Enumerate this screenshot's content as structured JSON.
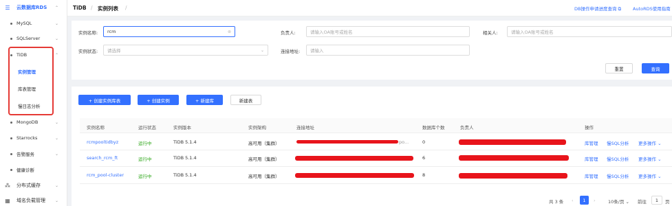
{
  "sidebar": {
    "top": {
      "label": "云数据库RDS",
      "icon": "grid-menu-icon"
    },
    "items": [
      {
        "label": "MySQL"
      },
      {
        "label": "SQLServer"
      },
      {
        "label": "TiDB"
      },
      {
        "label": "实例管理"
      },
      {
        "label": "库表管理"
      },
      {
        "label": "慢日志分析"
      },
      {
        "label": "MongoDB"
      },
      {
        "label": "Starrocks"
      },
      {
        "label": "告警服务"
      },
      {
        "label": "健康诊断"
      },
      {
        "label": "分布式缓存"
      },
      {
        "label": "域名负载管理"
      }
    ]
  },
  "header": {
    "crumb1": "TiDB",
    "sep1": "/",
    "crumb2": "实例列表",
    "sep2": "/",
    "link1": "DB操作申请进度查询",
    "link2": "AutoRDS使用指南"
  },
  "search": {
    "name_label": "实例名称:",
    "name_value": "rcm",
    "owner_label": "负责人:",
    "owner_placeholder": "请输入OA账号或姓名",
    "related_label": "相关人:",
    "related_placeholder": "请输入OA账号或姓名",
    "status_label": "实例状态:",
    "status_placeholder": "请选择",
    "addr_label": "连接地址:",
    "addr_placeholder": "请输入",
    "reset": "重置",
    "query": "查询"
  },
  "toolbar": {
    "create_db_instance": "+ 创建实例库表",
    "create_instance": "+ 创建实例",
    "create_db": "+ 新建库",
    "create_table": "新建表"
  },
  "table": {
    "columns": [
      "实例名称",
      "运行状态",
      "实例版本",
      "实例架构",
      "连接地址",
      "数据库个数",
      "负责人",
      "操作"
    ],
    "rows": [
      {
        "name": "rcmpooltidbyz",
        "status": "运行中",
        "version": "TiDB 5.1.4",
        "arch": "高可用（集群）",
        "addr_tail": "po...",
        "db_count": "0"
      },
      {
        "name": "search_rcm_ft",
        "status": "运行中",
        "version": "TiDB 5.1.4",
        "arch": "高可用（集群）",
        "addr_tail": "",
        "db_count": "6"
      },
      {
        "name": "rcm_pool-cluster",
        "status": "运行中",
        "version": "TiDB 5.1.4",
        "arch": "高可用（集群）",
        "addr_tail": "",
        "db_count": "8"
      }
    ],
    "actions": {
      "db_manage": "库管理",
      "slow_sql": "慢SQL分析",
      "more": "更多操作"
    }
  },
  "pagination": {
    "total": "共 3 条",
    "current": "1",
    "page_size": "10条/页",
    "goto": "前往",
    "goto_value": "1",
    "page_suffix": "页"
  }
}
